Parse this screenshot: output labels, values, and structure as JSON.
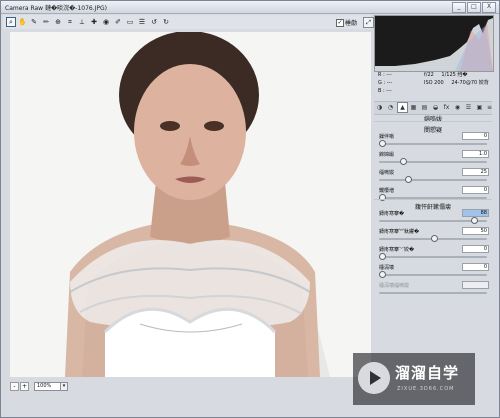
{
  "window": {
    "title": "Camera Raw  鏈�晱浣�-1076.JPG)",
    "buttons": [
      "_",
      "□",
      "X"
    ]
  },
  "toolbar": {
    "tools": [
      "zoom-icon",
      "hand-icon",
      "white-balance-icon",
      "color-sampler-icon",
      "target-adjust-icon",
      "crop-icon",
      "straighten-icon",
      "spot-removal-icon",
      "red-eye-icon",
      "adjustment-brush-icon",
      "gradient-filter-icon",
      "preferences-icon",
      "rotate-ccw-icon",
      "rotate-cw-icon"
    ],
    "preview_label": "棰勮",
    "preview_checked": true,
    "fullscreen_label": "⤢"
  },
  "histogram": {
    "rgb_r": "R :",
    "rgb_g": "G :",
    "rgb_b": "B :",
    "dash": "---",
    "aperture": "f/22",
    "shutter": "1/125 绉�",
    "iso": "ISO 200",
    "lens": "24-70@70 姣背"
  },
  "panel": {
    "section_title": "缁嗚妭",
    "sharpen_title": "閿愬寲",
    "sharpen_rows": [
      {
        "label": "鏁伴噺",
        "value": "0",
        "level": 0.0
      },
      {
        "label": "鍗婂緞",
        "value": "1.0",
        "level": 0.2
      },
      {
        "label": "缁嗚妭",
        "value": "25",
        "level": 0.25
      },
      {
        "label": "钂欑増",
        "value": "0",
        "level": 0.0
      }
    ],
    "noise_title": "鍑忓皯鏉傝壊",
    "noise_rows": [
      {
        "label": "鏄庝寒搴�",
        "value": "88",
        "level": 0.88,
        "selected": true
      },
      {
        "label": "鏄庝寒搴︾粏鑺�",
        "value": "50",
        "level": 0.5
      },
      {
        "label": "鏄庝寒搴﹀姣�",
        "value": "0",
        "level": 0.0
      },
      {
        "label": "棰滆壊",
        "value": "0",
        "level": 0.0
      },
      {
        "label": "棰滆壊缁嗚妭",
        "value": "",
        "level": 0.0,
        "disabled": true
      }
    ]
  },
  "zoom": {
    "minus": "-",
    "plus": "+",
    "value": "100%",
    "dropdown": "▾"
  },
  "watermark": {
    "title": "溜溜自学",
    "subtitle": "ZIXUE.3D66.COM"
  }
}
